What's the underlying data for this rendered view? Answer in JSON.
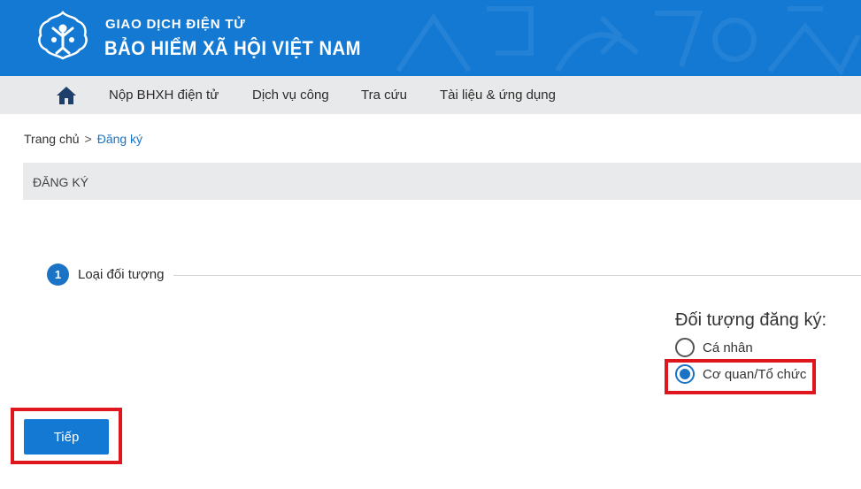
{
  "header": {
    "brand_line1": "GIAO DỊCH ĐIỆN TỬ",
    "brand_line2": "BẢO HIỂM XÃ HỘI VIỆT NAM",
    "logo_text": "BẢO HIỂM XÃ HỘI VIỆT NAM",
    "background_color": "#1479d2"
  },
  "nav": {
    "home_icon": "home-icon",
    "items": [
      {
        "label": "Nộp BHXH điện tử"
      },
      {
        "label": "Dịch vụ công"
      },
      {
        "label": "Tra cứu"
      },
      {
        "label": "Tài liệu & ứng dụng"
      }
    ]
  },
  "breadcrumb": {
    "home": "Trang chủ",
    "separator": ">",
    "current": "Đăng ký"
  },
  "section": {
    "title": "ĐĂNG KÝ"
  },
  "step": {
    "number": "1",
    "label": "Loại đối tượng"
  },
  "registration_type": {
    "label": "Đối tượng đăng ký:",
    "options": [
      {
        "label": "Cá nhân",
        "checked": false
      },
      {
        "label": "Cơ quan/Tổ chức",
        "checked": true
      }
    ]
  },
  "actions": {
    "next_label": "Tiếp"
  },
  "colors": {
    "accent": "#1a73c5",
    "highlight": "#e0161e",
    "nav_bg": "#e8e9ea"
  }
}
